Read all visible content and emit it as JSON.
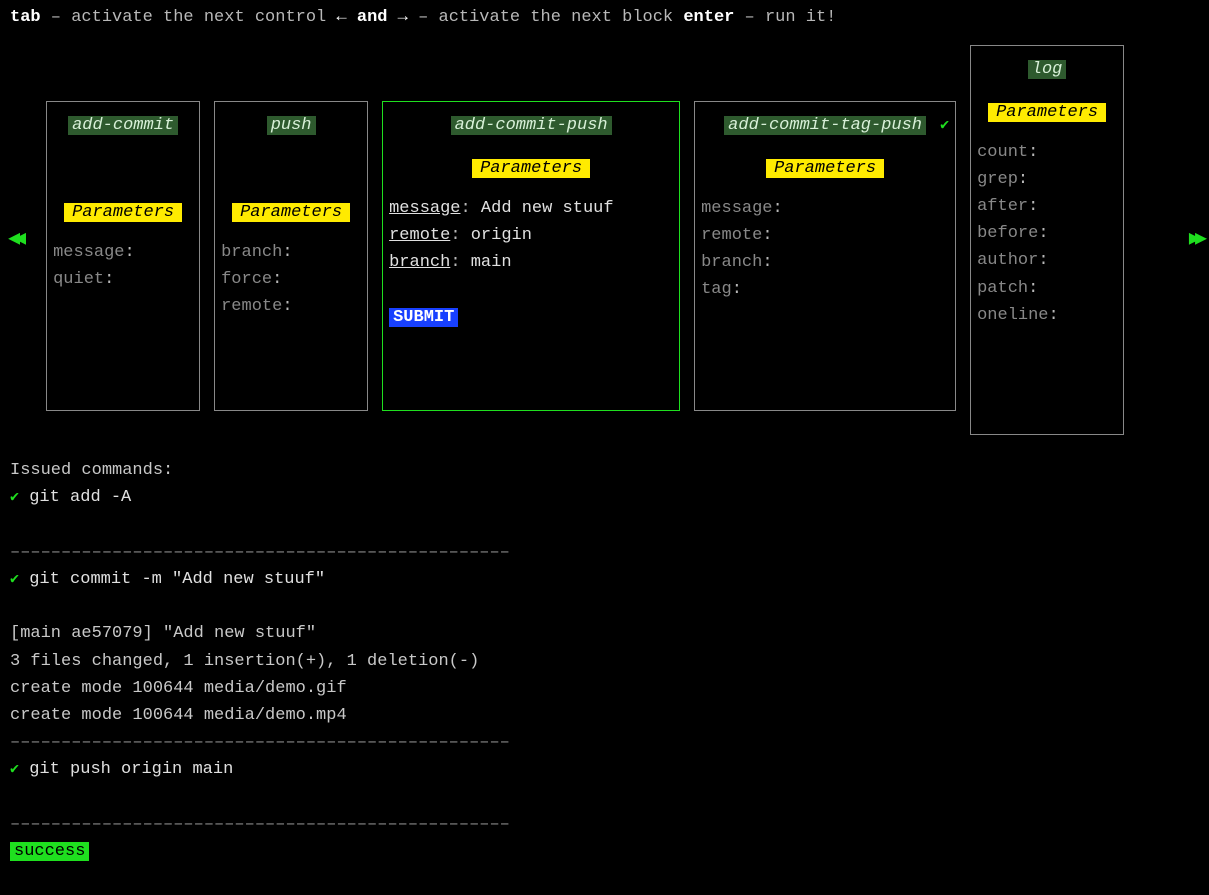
{
  "help": {
    "tab_kw": "tab",
    "tab_txt": " – activate the next control   ",
    "arrows_kw": "← and →",
    "arrows_txt": "  – activate the next block   ",
    "enter_kw": "enter",
    "enter_txt": " – run it!"
  },
  "nav": {
    "left": "◀◀",
    "right": "▶▶"
  },
  "params_label": "Parameters",
  "blocks": {
    "add_commit": {
      "title": "add-commit",
      "params": [
        {
          "name": "message",
          "value": ""
        },
        {
          "name": "quiet",
          "value": ""
        }
      ]
    },
    "push": {
      "title": "push",
      "params": [
        {
          "name": "branch",
          "value": ""
        },
        {
          "name": "force",
          "value": ""
        },
        {
          "name": "remote",
          "value": ""
        }
      ]
    },
    "add_commit_push": {
      "title": "add-commit-push",
      "params": [
        {
          "name": "message",
          "value": "Add new stuuf"
        },
        {
          "name": "remote",
          "value": "origin"
        },
        {
          "name": "branch",
          "value": "main"
        }
      ],
      "submit": "SUBMIT"
    },
    "add_commit_tag_push": {
      "title": "add-commit-tag-push",
      "check": "✔",
      "params": [
        {
          "name": "message",
          "value": ""
        },
        {
          "name": "remote",
          "value": ""
        },
        {
          "name": "branch",
          "value": ""
        },
        {
          "name": "tag",
          "value": ""
        }
      ]
    },
    "log": {
      "title": "log",
      "params": [
        {
          "name": "count",
          "value": ""
        },
        {
          "name": "grep",
          "value": ""
        },
        {
          "name": "after",
          "value": ""
        },
        {
          "name": "before",
          "value": ""
        },
        {
          "name": "author",
          "value": ""
        },
        {
          "name": "patch",
          "value": ""
        },
        {
          "name": "oneline",
          "value": ""
        }
      ]
    }
  },
  "output": {
    "heading": "Issued commands:",
    "cmd1_ok": "✔",
    "cmd1": " git add -A",
    "hr": "–––––––––––––––––––––––––––––––––––––––––––––––––",
    "cmd2_ok": "✔",
    "cmd2": " git commit -m \"Add new stuuf\"",
    "commit_out1": "[main ae57079] \"Add new stuuf\"",
    "commit_out2": " 3 files changed, 1 insertion(+), 1 deletion(-)",
    "commit_out3": " create mode 100644 media/demo.gif",
    "commit_out4": " create mode 100644 media/demo.mp4",
    "cmd3_ok": "✔",
    "cmd3": " git push origin main",
    "success": "success"
  }
}
